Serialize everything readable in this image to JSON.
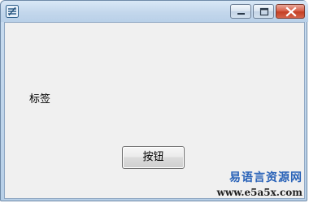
{
  "window": {
    "controls": {
      "minimize_icon": "minimize-icon",
      "maximize_icon": "maximize-icon",
      "close_icon": "close-icon"
    }
  },
  "content": {
    "label_text": "标签",
    "button_label": "按钮"
  },
  "watermark": {
    "line1": "易语言资源网",
    "line2": "www.e5a5x.com"
  },
  "colors": {
    "title_gradient_top": "#d9e8f6",
    "client_bg": "#f0f0f0",
    "close_button": "#c43f24",
    "watermark_blue": "#2a63b8"
  }
}
